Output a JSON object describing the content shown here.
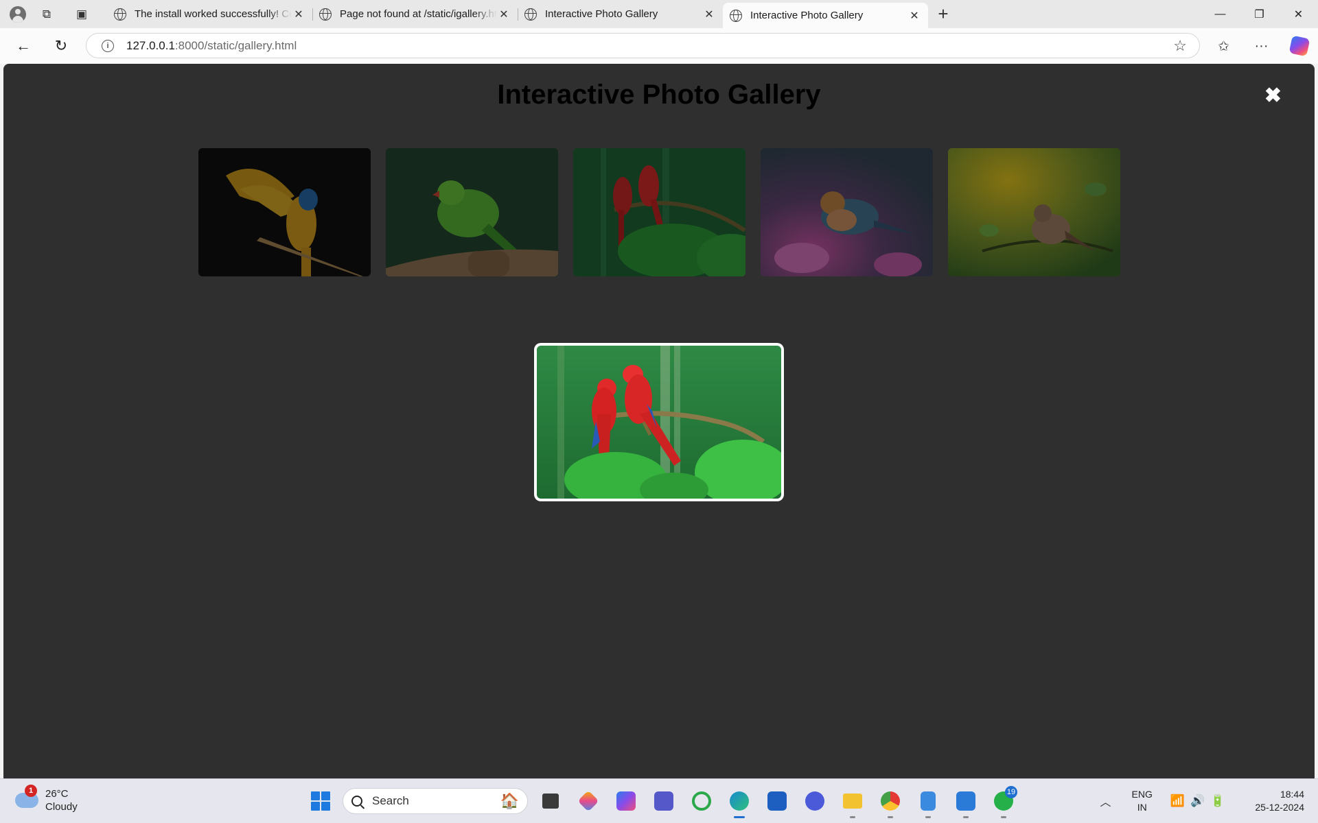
{
  "browser": {
    "tabs": [
      {
        "title": "The install worked successfully! Congratulations!",
        "active": false
      },
      {
        "title": "Page not found at /static/igallery.html",
        "active": false
      },
      {
        "title": "Interactive Photo Gallery",
        "active": false
      },
      {
        "title": "Interactive Photo Gallery",
        "active": true
      }
    ],
    "url_host": "127.0.0.1",
    "url_path": ":8000/static/gallery.html"
  },
  "page": {
    "title": "Interactive Photo Gallery",
    "close_symbol": "✖",
    "thumbnails": [
      {
        "subject": "blue-and-gold macaw spreading wings"
      },
      {
        "subject": "green parrot on perch"
      },
      {
        "subject": "two scarlet macaws on branch"
      },
      {
        "subject": "small bird among pink flowers"
      },
      {
        "subject": "sparrow on branch with yellow backdrop"
      }
    ],
    "lightbox": {
      "subject": "two scarlet macaws on branch"
    }
  },
  "taskbar": {
    "weather_temp": "26°C",
    "weather_desc": "Cloudy",
    "weather_badge": "1",
    "search_label": "Search",
    "whatsapp_badge": "19",
    "lang_top": "ENG",
    "lang_bottom": "IN",
    "time": "18:44",
    "date": "25-12-2024"
  }
}
